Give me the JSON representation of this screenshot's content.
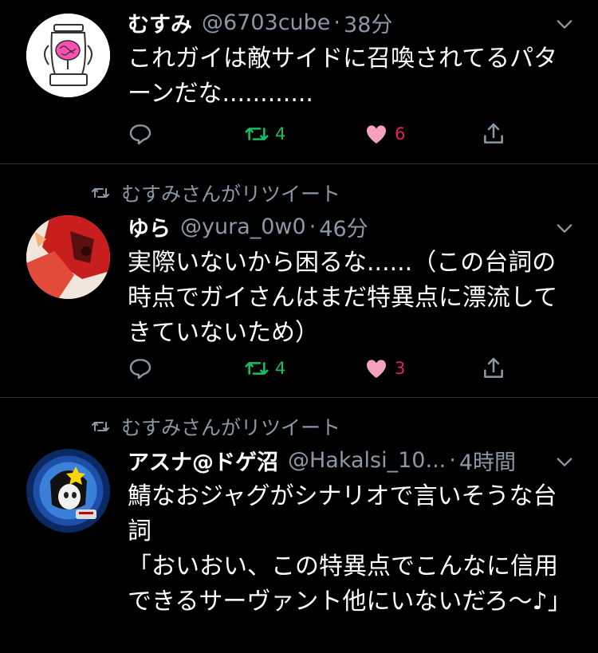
{
  "tweets": [
    {
      "name": "むすみ",
      "handle": "@6703cube",
      "separator": "·",
      "time": "38分",
      "text": "これガイは敵サイドに召喚されてるパターンだな............",
      "retweets": "4",
      "likes": "6",
      "retweeted_by": ""
    },
    {
      "name": "ゆら",
      "handle": "@yura_0w0",
      "separator": "·",
      "time": "46分",
      "text": "実際いないから困るな......（この台詞の時点でガイさんはまだ特異点に漂流してきていないため）",
      "retweets": "4",
      "likes": "3",
      "retweeted_by": "むすみさんがリツイート"
    },
    {
      "name": "アスナ@ドゲ沼",
      "handle": "@Hakalsi_10...",
      "separator": "·",
      "time": "4時間",
      "text": "鯖なおジャグがシナリオで言いそうな台詞\n「おいおい、この特異点でこんなに信用できるサーヴァント他にいないだろ〜♪」",
      "retweets": "",
      "likes": "",
      "retweeted_by": "むすみさんがリツイート"
    }
  ],
  "colors": {
    "background": "#000000",
    "secondary_text": "#8b98a5",
    "retweet_green": "#17bf63",
    "like_pink": "#e0245e",
    "divider": "#2f3336"
  },
  "icons": [
    "reply-icon",
    "retweet-icon",
    "like-icon",
    "share-icon",
    "chevron-down-icon"
  ]
}
